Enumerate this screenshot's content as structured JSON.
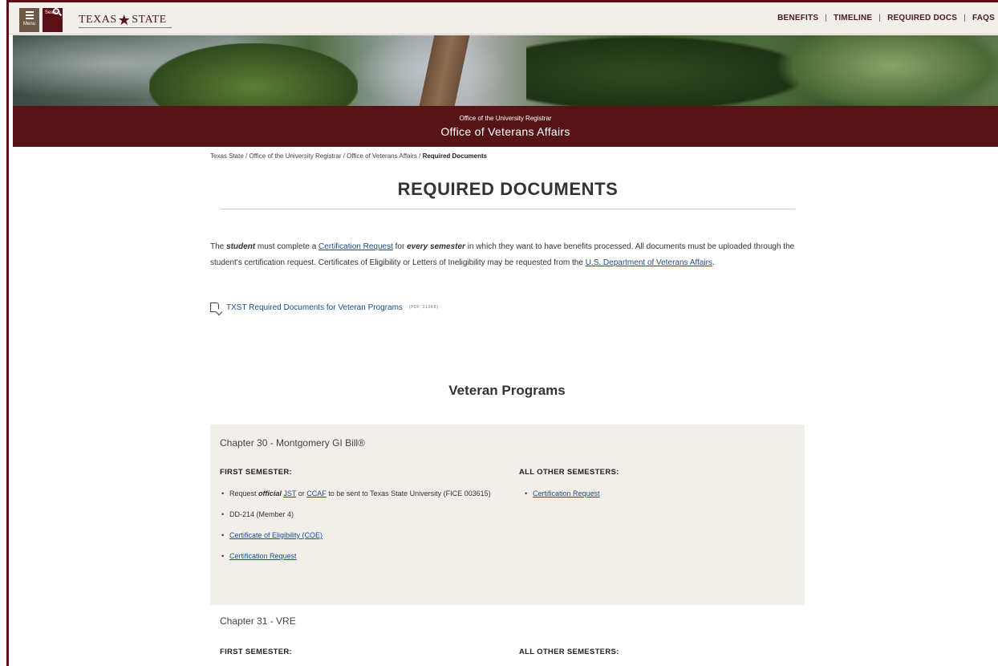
{
  "topbar": {
    "menu_label": "Menu",
    "search_label": "Search",
    "logo_left": "TEXAS",
    "logo_right": "STATE",
    "nav": [
      "BENEFITS",
      "TIMELINE",
      "REQUIRED DOCS",
      "FAQS"
    ],
    "nav_sep": "|"
  },
  "banner": {
    "subtitle": "Office of the University Registrar",
    "title": "Office of Veterans Affairs"
  },
  "breadcrumb": {
    "items": [
      "Texas State",
      "Office of the University Registrar",
      "Office of Veterans Affairs"
    ],
    "sep": " / ",
    "current": "Required Documents"
  },
  "page_title": "REQUIRED DOCUMENTS",
  "intro": {
    "t1": "The ",
    "student": "student",
    "t2": " must complete a ",
    "cert_link": "Certification Request",
    "t3": " for ",
    "every_semester": "every semester",
    "t4": " in which they want to have benefits processed. All documents must be uploaded through the student's certification request. Certificates of Eligibility or Letters of Ineligibility may be requested from the ",
    "va_link": "U.S. Department of Veterans Affairs",
    "t5": "."
  },
  "pdf": {
    "label": "TXST Required Documents for Veteran Programs",
    "meta": "(PDF, 313KB)"
  },
  "section_title": "Veteran Programs",
  "programs": [
    {
      "title": "Chapter 30 - Montgomery GI Bill®",
      "first_head": "FIRST SEMESTER:",
      "other_head": "ALL OTHER SEMESTERS:",
      "first_items": {
        "req_pre": "Request ",
        "official": "official",
        "jst": "JST",
        "or": " or ",
        "ccaf": "CCAF",
        "req_post": " to be sent to Texas State University (FICE 003615)",
        "dd214": "DD-214 (Member 4)",
        "coe": "Certificate of Eligibility (COE)",
        "cert": "Certification Request"
      },
      "other_items": [
        "Certification Request"
      ]
    },
    {
      "title": "Chapter 31 - VRE",
      "first_head": "FIRST SEMESTER:",
      "other_head": "ALL OTHER SEMESTERS:"
    }
  ]
}
